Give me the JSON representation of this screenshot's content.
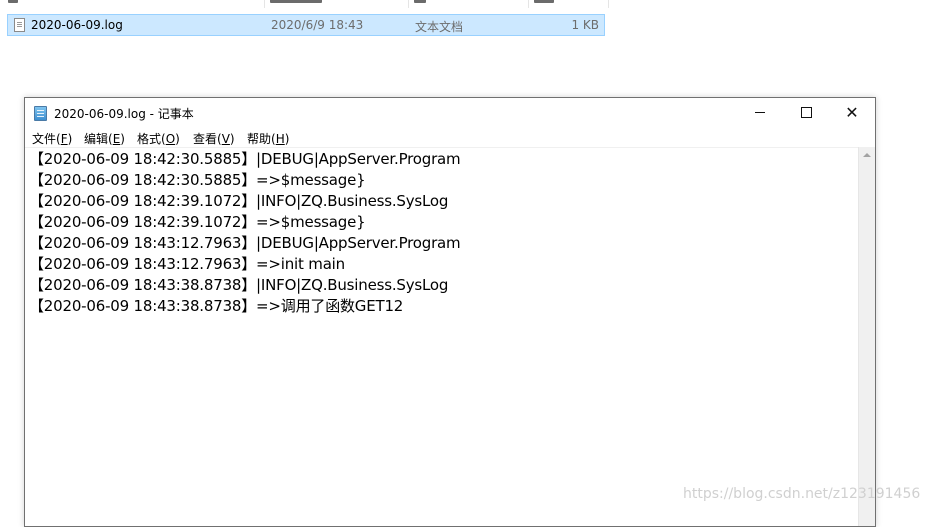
{
  "explorer": {
    "file": {
      "name": "2020-06-09.log",
      "date_modified": "2020/6/9 18:43",
      "type": "文本文档",
      "size": "1 KB"
    }
  },
  "notepad": {
    "window_title": "2020-06-09.log - 记事本",
    "caption_buttons": {
      "minimize": "",
      "maximize": "",
      "close": "✕"
    },
    "menu": [
      {
        "label": "文件",
        "hotkey": "F"
      },
      {
        "label": "编辑",
        "hotkey": "E"
      },
      {
        "label": "格式",
        "hotkey": "O"
      },
      {
        "label": "查看",
        "hotkey": "V"
      },
      {
        "label": "帮助",
        "hotkey": "H"
      }
    ],
    "lines": [
      "【2020-06-09 18:42:30.5885】|DEBUG|AppServer.Program",
      "【2020-06-09 18:42:30.5885】=>$message}",
      "【2020-06-09 18:42:39.1072】|INFO|ZQ.Business.SysLog",
      "【2020-06-09 18:42:39.1072】=>$message}",
      "【2020-06-09 18:43:12.7963】|DEBUG|AppServer.Program",
      "【2020-06-09 18:43:12.7963】=>init main",
      "【2020-06-09 18:43:38.8738】|INFO|ZQ.Business.SysLog",
      "【2020-06-09 18:43:38.8738】=>调用了函数GET12"
    ]
  },
  "watermark": "https://blog.csdn.net/z123191456"
}
